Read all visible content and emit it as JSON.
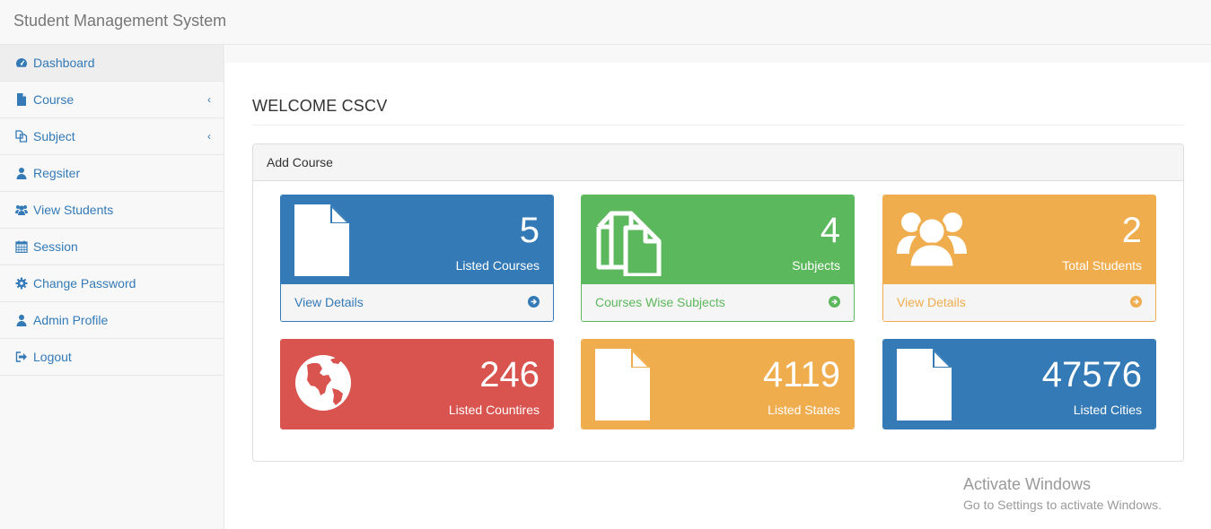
{
  "header": {
    "brand": "Student Management System"
  },
  "sidebar": {
    "items": [
      {
        "label": "Dashboard",
        "icon": "dashboard-icon"
      },
      {
        "label": "Course",
        "icon": "file-icon",
        "caret": "‹"
      },
      {
        "label": "Subject",
        "icon": "copy-icon",
        "caret": "‹"
      },
      {
        "label": "Regsiter",
        "icon": "user-icon"
      },
      {
        "label": "View Students",
        "icon": "users-icon"
      },
      {
        "label": "Session",
        "icon": "calendar-icon"
      },
      {
        "label": "Change Password",
        "icon": "gear-icon"
      },
      {
        "label": "Admin Profile",
        "icon": "user-icon"
      },
      {
        "label": "Logout",
        "icon": "sign-out-icon"
      }
    ]
  },
  "main": {
    "title": "WELCOME CSCV",
    "panel_heading": "Add Course",
    "cards": [
      {
        "number": "5",
        "label": "Listed Courses",
        "footer": "View Details",
        "color": "#337ab7",
        "icon": "file-icon"
      },
      {
        "number": "4",
        "label": "Subjects",
        "footer": "Courses Wise Subjects",
        "color": "#5cb85c",
        "icon": "copy-icon"
      },
      {
        "number": "2",
        "label": "Total Students",
        "footer": "View Details",
        "color": "#f0ad4e",
        "icon": "users-icon"
      },
      {
        "number": "246",
        "label": "Listed Countires",
        "color": "#d9534f",
        "icon": "globe-icon"
      },
      {
        "number": "4119",
        "label": "Listed States",
        "color": "#f0ad4e",
        "icon": "file-icon"
      },
      {
        "number": "47576",
        "label": "Listed Cities",
        "color": "#337ab7",
        "icon": "file-icon"
      }
    ]
  },
  "watermark": {
    "line1": "Activate Windows",
    "line2": "Go to Settings to activate Windows."
  }
}
